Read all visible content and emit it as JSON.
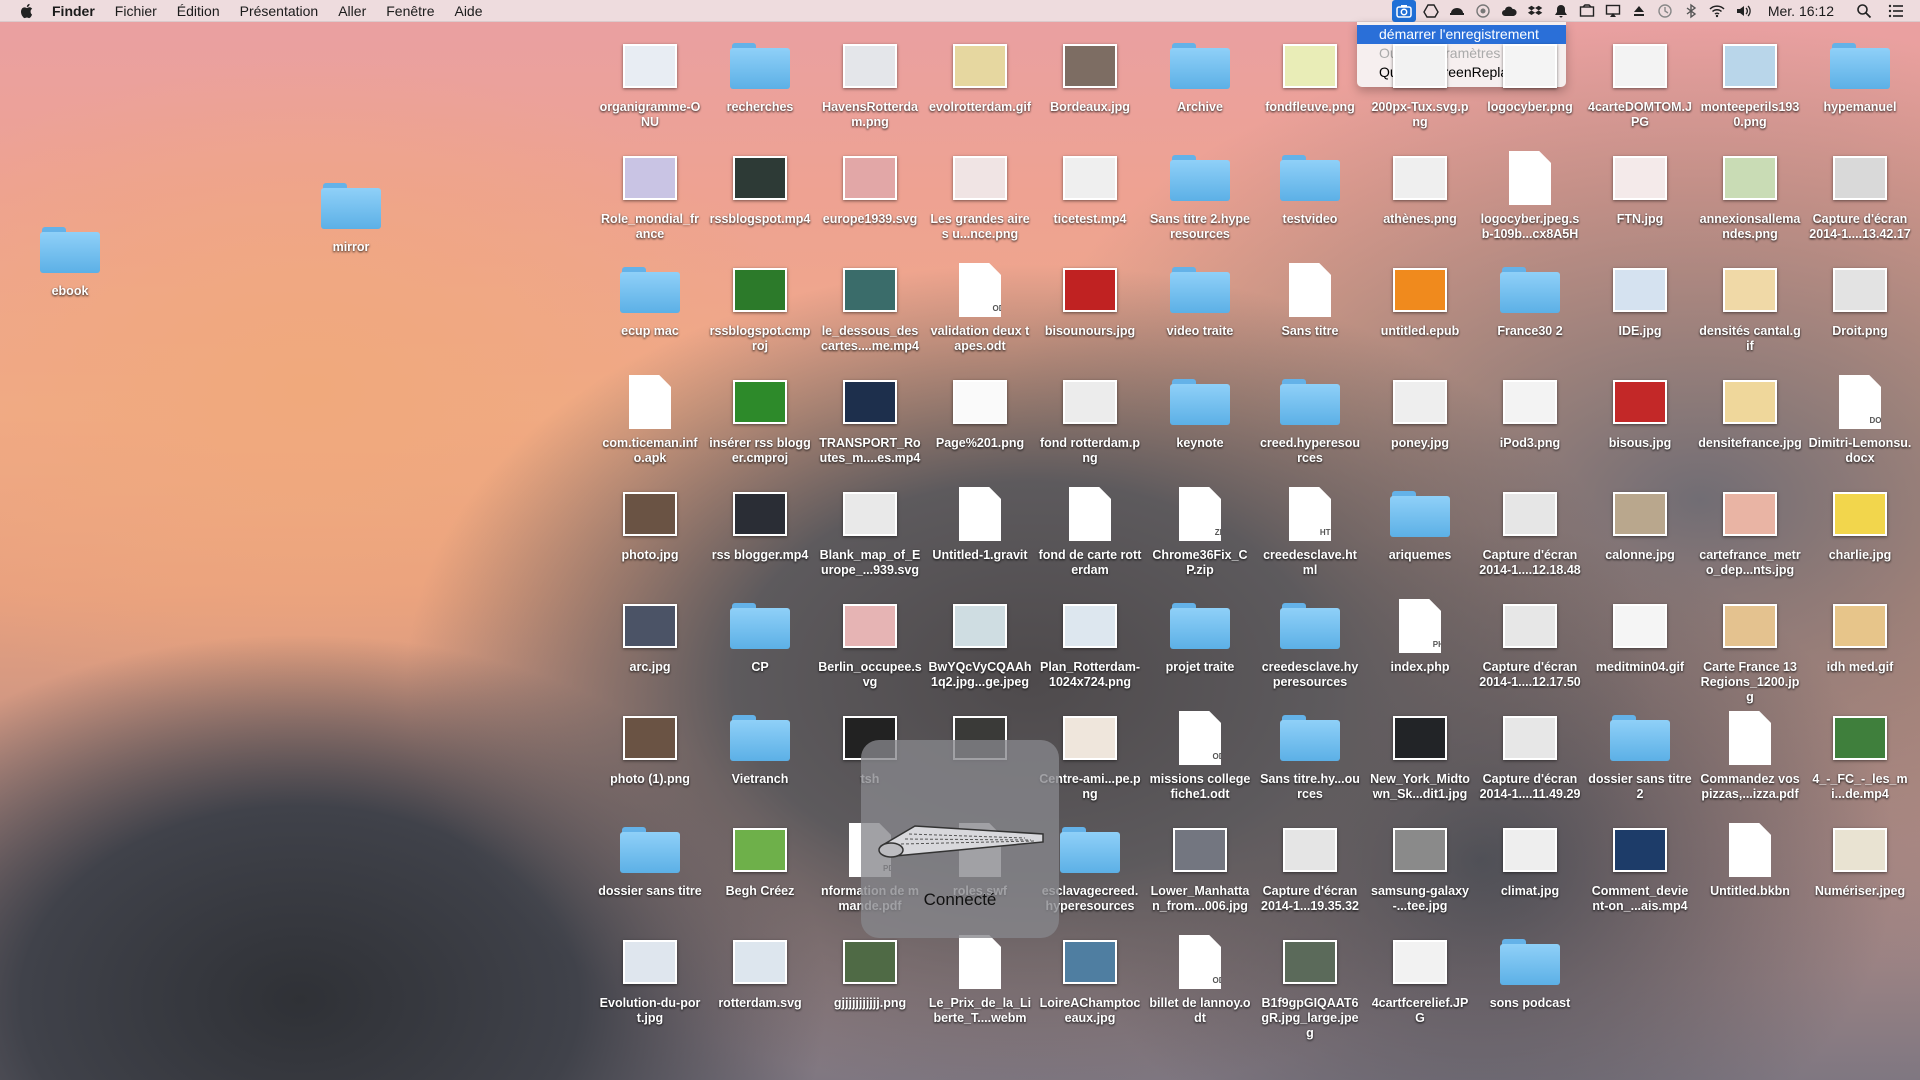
{
  "menubar": {
    "app": "Finder",
    "items": [
      "Fichier",
      "Édition",
      "Présentation",
      "Aller",
      "Fenêtre",
      "Aide"
    ],
    "clock": "Mer. 16:12"
  },
  "screenreplay_menu": {
    "items": [
      "démarrer l'enregistrement",
      "Ouvrez Paramètres",
      "Quittez ScreenReplay"
    ]
  },
  "hud": {
    "message": "Connecté"
  },
  "desktop": [
    {
      "label": "ebook",
      "kind": "folder"
    },
    {
      "label": "mirror",
      "kind": "folder"
    },
    {
      "label": "organigramme-ONU",
      "kind": "image",
      "color": "#e8edf3"
    },
    {
      "label": "recherches",
      "kind": "folder"
    },
    {
      "label": "HavensRotterdam.png",
      "kind": "image",
      "color": "#e4e6ea"
    },
    {
      "label": "evolrotterdam.gif",
      "kind": "image",
      "color": "#e6d7a0"
    },
    {
      "label": "Bordeaux.jpg",
      "kind": "image",
      "color": "#7d6d63"
    },
    {
      "label": "Archive",
      "kind": "folder"
    },
    {
      "label": "fondfleuve.png",
      "kind": "image",
      "color": "#e9edb7"
    },
    {
      "label": "200px-Tux.svg.png",
      "kind": "image",
      "color": "#f2f2f2"
    },
    {
      "label": "logocyber.png",
      "kind": "image",
      "color": "#f4f4f4"
    },
    {
      "label": "4carteDOMTOM.JPG",
      "kind": "image",
      "color": "#f3f3f3"
    },
    {
      "label": "monteeperils1930.png",
      "kind": "image",
      "color": "#b9d6ea"
    },
    {
      "label": "hypemanuel",
      "kind": "folder"
    },
    {
      "label": "Role_mondial_france",
      "kind": "image",
      "color": "#c9c4e4"
    },
    {
      "label": "rssblogspot.mp4",
      "kind": "image",
      "color": "#2d3a36"
    },
    {
      "label": "europe1939.svg",
      "kind": "image",
      "color": "#e2a7a7"
    },
    {
      "label": "Les grandes aires u...nce.png",
      "kind": "image",
      "color": "#f0e4e4"
    },
    {
      "label": "ticetest.mp4",
      "kind": "image",
      "color": "#efefef"
    },
    {
      "label": "Sans titre 2.hyperesources",
      "kind": "folder"
    },
    {
      "label": "testvideo",
      "kind": "folder"
    },
    {
      "label": "athènes.png",
      "kind": "image",
      "color": "#efefef"
    },
    {
      "label": "logocyber.jpeg.sb-109b...cx8A5H",
      "kind": "doc",
      "ext": ""
    },
    {
      "label": "FTN.jpg",
      "kind": "image",
      "color": "#f4eaea"
    },
    {
      "label": "annexionsallemandes.png",
      "kind": "image",
      "color": "#c9dcb5"
    },
    {
      "label": "Capture d'écran 2014-1....13.42.17",
      "kind": "image",
      "color": "#d9d9d9"
    },
    {
      "label": "ecup mac",
      "kind": "folder"
    },
    {
      "label": "rssblogspot.cmproj",
      "kind": "image",
      "color": "#2c7a2a"
    },
    {
      "label": "le_dessous_des cartes....me.mp4",
      "kind": "image",
      "color": "#3a6c6a"
    },
    {
      "label": "validation deux tapes.odt",
      "kind": "doc",
      "ext": "ODT"
    },
    {
      "label": "bisounours.jpg",
      "kind": "image",
      "color": "#c02222"
    },
    {
      "label": "video traite",
      "kind": "folder"
    },
    {
      "label": "Sans titre",
      "kind": "doc",
      "ext": ""
    },
    {
      "label": "untitled.epub",
      "kind": "image",
      "color": "#f08a1d"
    },
    {
      "label": "France30 2",
      "kind": "folder"
    },
    {
      "label": "IDE.jpg",
      "kind": "image",
      "color": "#d5e2f0"
    },
    {
      "label": "densités cantal.gif",
      "kind": "image",
      "color": "#f0d9a7"
    },
    {
      "label": "Droit.png",
      "kind": "image",
      "color": "#e3e3e3"
    },
    {
      "label": "com.ticeman.info.apk",
      "kind": "doc",
      "ext": ""
    },
    {
      "label": "insérer rss blogger.cmproj",
      "kind": "image",
      "color": "#2d8a2a"
    },
    {
      "label": "TRANSPORT_Routes_m....es.mp4",
      "kind": "image",
      "color": "#1d2f4c"
    },
    {
      "label": "Page%201.png",
      "kind": "image",
      "color": "#fafafa"
    },
    {
      "label": "fond rotterdam.png",
      "kind": "image",
      "color": "#ececec"
    },
    {
      "label": "keynote",
      "kind": "folder"
    },
    {
      "label": "creed.hyperesources",
      "kind": "folder"
    },
    {
      "label": "poney.jpg",
      "kind": "image",
      "color": "#eeeeee"
    },
    {
      "label": "iPod3.png",
      "kind": "image",
      "color": "#f3f3f3"
    },
    {
      "label": "bisous.jpg",
      "kind": "image",
      "color": "#c32828"
    },
    {
      "label": "densitefrance.jpg",
      "kind": "image",
      "color": "#efd79b"
    },
    {
      "label": "Dimitri-Lemonsu.docx",
      "kind": "doc",
      "ext": "DOCX"
    },
    {
      "label": "photo.jpg",
      "kind": "image",
      "color": "#6a5344"
    },
    {
      "label": "rss blogger.mp4",
      "kind": "image",
      "color": "#2a2d35"
    },
    {
      "label": "Blank_map_of_Europe_...939.svg",
      "kind": "image",
      "color": "#e9e9e9"
    },
    {
      "label": "Untitled-1.gravit",
      "kind": "doc",
      "ext": ""
    },
    {
      "label": "fond de carte rotterdam",
      "kind": "doc",
      "ext": ""
    },
    {
      "label": "Chrome36Fix_CP.zip",
      "kind": "doc",
      "ext": "ZIP"
    },
    {
      "label": "creedesclave.html",
      "kind": "doc",
      "ext": "HTML"
    },
    {
      "label": "ariquemes",
      "kind": "folder"
    },
    {
      "label": "Capture d'écran 2014-1....12.18.48",
      "kind": "image",
      "color": "#e6e6e6"
    },
    {
      "label": "calonne.jpg",
      "kind": "image",
      "color": "#b9a78d"
    },
    {
      "label": "cartefrance_metro_dep...nts.jpg",
      "kind": "image",
      "color": "#e9b4a4"
    },
    {
      "label": "charlie.jpg",
      "kind": "image",
      "color": "#f2d64c"
    },
    {
      "label": "arc.jpg",
      "kind": "image",
      "color": "#4b5366"
    },
    {
      "label": "CP",
      "kind": "folder"
    },
    {
      "label": "Berlin_occupee.svg",
      "kind": "image",
      "color": "#e6b4b4"
    },
    {
      "label": "BwYQcVyCQAAh1q2.jpg...ge.jpeg",
      "kind": "image",
      "color": "#cfdde2"
    },
    {
      "label": "Plan_Rotterdam-1024x724.png",
      "kind": "image",
      "color": "#dde7ef"
    },
    {
      "label": "projet traite",
      "kind": "folder"
    },
    {
      "label": "creedesclave.hyperesources",
      "kind": "folder"
    },
    {
      "label": "index.php",
      "kind": "doc",
      "ext": "PHP"
    },
    {
      "label": "Capture d'écran 2014-1....12.17.50",
      "kind": "image",
      "color": "#e7e7e7"
    },
    {
      "label": "meditmin04.gif",
      "kind": "image",
      "color": "#f5f5f5"
    },
    {
      "label": "Carte France 13 Regions_1200.jpg",
      "kind": "image",
      "color": "#e4c28f"
    },
    {
      "label": "idh med.gif",
      "kind": "image",
      "color": "#e7c58a"
    },
    {
      "label": "photo (1).png",
      "kind": "image",
      "color": "#6a5344"
    },
    {
      "label": "Vietranch",
      "kind": "folder"
    },
    {
      "label": "tsh",
      "kind": "image",
      "color": "#222222"
    },
    {
      "label": "",
      "kind": "image",
      "color": "#3a3a38"
    },
    {
      "label": "Centre-ami...pe.png",
      "kind": "image",
      "color": "#efe6dc"
    },
    {
      "label": "missions college fiche1.odt",
      "kind": "doc",
      "ext": "ODT"
    },
    {
      "label": "Sans titre.hy...ources",
      "kind": "folder"
    },
    {
      "label": "New_York_Midtown_Sk...dit1.jpg",
      "kind": "image",
      "color": "#222427"
    },
    {
      "label": "Capture d'écran 2014-1....11.49.29",
      "kind": "image",
      "color": "#e7e7e7"
    },
    {
      "label": "dossier sans titre 2",
      "kind": "folder"
    },
    {
      "label": "Commandez vos pizzas,...izza.pdf",
      "kind": "doc",
      "ext": ""
    },
    {
      "label": "4_-_FC_-_les_mi...de.mp4",
      "kind": "image",
      "color": "#3f7f3c"
    },
    {
      "label": "dossier sans titre",
      "kind": "folder"
    },
    {
      "label": "Begh Créez",
      "kind": "image",
      "color": "#6eb04a"
    },
    {
      "label": "nformation de mmande.pdf",
      "kind": "doc",
      "ext": "PDF"
    },
    {
      "label": "roles.swf",
      "kind": "doc",
      "ext": ""
    },
    {
      "label": "esclavagecreed.hyperesources",
      "kind": "folder"
    },
    {
      "label": "Lower_Manhattan_from...006.jpg",
      "kind": "image",
      "color": "#737680"
    },
    {
      "label": "Capture d'écran 2014-1...19.35.32",
      "kind": "image",
      "color": "#e5e5e5"
    },
    {
      "label": "samsung-galaxy-...tee.jpg",
      "kind": "image",
      "color": "#8a8a8a"
    },
    {
      "label": "climat.jpg",
      "kind": "image",
      "color": "#eeeeee"
    },
    {
      "label": "Comment_devient-on_...ais.mp4",
      "kind": "image",
      "color": "#1d3c69"
    },
    {
      "label": "Untitled.bkbn",
      "kind": "doc",
      "ext": ""
    },
    {
      "label": "Numériser.jpeg",
      "kind": "image",
      "color": "#e9e3d2"
    },
    {
      "label": "Evolution-du-port.jpg",
      "kind": "image",
      "color": "#dfe6ee"
    },
    {
      "label": "rotterdam.svg",
      "kind": "image",
      "color": "#dde6ee"
    },
    {
      "label": "gjjjjjjjjjjj.png",
      "kind": "image",
      "color": "#4f6a45"
    },
    {
      "label": "Le_Prix_de_la_Liberte_T....webm",
      "kind": "doc",
      "ext": ""
    },
    {
      "label": "LoireAChamptoceaux.jpg",
      "kind": "image",
      "color": "#4f7ea1"
    },
    {
      "label": "billet de lannoy.odt",
      "kind": "doc",
      "ext": "ODT"
    },
    {
      "label": "B1f9gpGIQAAT6gR.jpg_large.jpeg",
      "kind": "image",
      "color": "#5b6a5a"
    },
    {
      "label": "4cartfcerelief.JPG",
      "kind": "image",
      "color": "#f2f2f2"
    },
    {
      "label": "sons podcast",
      "kind": "folder"
    }
  ]
}
